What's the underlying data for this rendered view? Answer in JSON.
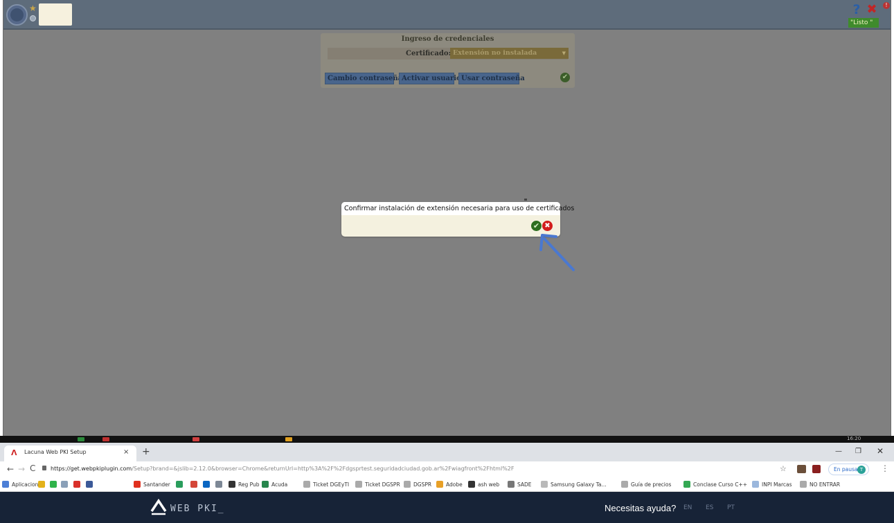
{
  "app": {
    "status_badge": "\"Listo \"",
    "help_glyph": "?",
    "close_glyph": "✖",
    "alert_glyph": "!",
    "login_panel": {
      "title": "Ingreso de credenciales",
      "certificate_label": "Certificado:",
      "certificate_value": "Extensión no instalada",
      "buttons": {
        "change_password": "Cambio contraseña",
        "activate_user": "Activar usuario",
        "use_password": "Usar contraseña"
      }
    },
    "dialog": {
      "message": "Confirmar instalación de extensión necesaria para uso de certificados"
    }
  },
  "taskbar": {
    "clock": "16:20"
  },
  "browser": {
    "tab_title": "Lacuna Web PKI Setup",
    "tab_close_glyph": "×",
    "new_tab_glyph": "+",
    "url_host": "https://get.webpkiplugin.com",
    "url_path": "/Setup?brand=&jslib=2.12.0&browser=Chrome&returnUrl=http%3A%2F%2Fdgsprtest.seguridadciudad.gob.ar%2Fwiagfront%2Fhtml%2F",
    "paused_label": "En pausa",
    "profile_initial": "T",
    "bookmarks": [
      {
        "label": "Aplicaciones",
        "color": "#4c7fd6"
      },
      {
        "label": "",
        "color": "#e3b21a"
      },
      {
        "label": "",
        "color": "#2fb34a"
      },
      {
        "label": "",
        "color": "#8aa0b8"
      },
      {
        "label": "",
        "color": "#d9302a"
      },
      {
        "label": "",
        "color": "#3b5998"
      },
      {
        "label": "Santander",
        "color": "#e0301e"
      },
      {
        "label": "",
        "color": "#2a9d5c"
      },
      {
        "label": "",
        "color": "#d44638"
      },
      {
        "label": "",
        "color": "#0a66c2"
      },
      {
        "label": "",
        "color": "#7d8896"
      },
      {
        "label": "Reg Pub",
        "color": "#333333"
      },
      {
        "label": "Acuda",
        "color": "#27864d"
      },
      {
        "label": "Ticket DGEyTI",
        "color": "#aaaaaa"
      },
      {
        "label": "Ticket DGSPR",
        "color": "#aaaaaa"
      },
      {
        "label": "DGSPR",
        "color": "#aaaaaa"
      },
      {
        "label": "Adobe",
        "color": "#e8a027"
      },
      {
        "label": "ash web",
        "color": "#333333"
      },
      {
        "label": "SADE",
        "color": "#777777"
      },
      {
        "label": "Samsung Galaxy Ta...",
        "color": "#b9b9b9"
      },
      {
        "label": "Guía de precios",
        "color": "#aaaaaa"
      },
      {
        "label": "Conclase Curso C++",
        "color": "#34a853"
      },
      {
        "label": "INPI Marcas",
        "color": "#9bb7dc"
      },
      {
        "label": "NO ENTRAR",
        "color": "#aaaaaa"
      }
    ]
  },
  "webpki": {
    "logo_text": "WEB PKI_",
    "help_text": "Necesitas ayuda?",
    "languages": [
      "EN",
      "ES",
      "PT"
    ]
  },
  "colors": {
    "dialog_bg": "#f4f1df",
    "annotation_arrow": "#4a78d0",
    "webpki_bg": "#172337"
  },
  "icons": [
    "star-icon",
    "help-icon",
    "close-icon",
    "check-icon",
    "cancel-icon",
    "arrow-icon",
    "lock-icon",
    "bookmark-star-icon",
    "kebab-menu-icon"
  ]
}
